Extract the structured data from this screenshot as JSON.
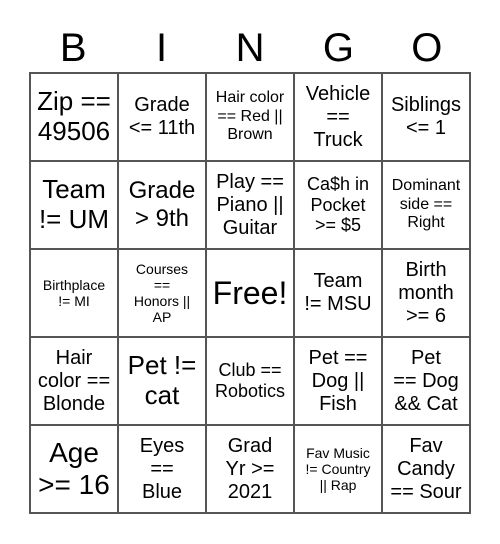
{
  "header": [
    "B",
    "I",
    "N",
    "G",
    "O"
  ],
  "cells": [
    "Zip ==\n49506",
    "Grade\n<= 11th",
    "Hair color\n== Red ||\nBrown",
    "Vehicle\n==\nTruck",
    "Siblings\n<= 1",
    "Team\n!= UM",
    "Grade\n> 9th",
    "Play ==\nPiano ||\nGuitar",
    "Ca$h in\nPocket\n>= $5",
    "Dominant\nside ==\nRight",
    "Birthplace\n!= MI",
    "Courses\n==\nHonors ||\nAP",
    "Free!",
    "Team\n!= MSU",
    "Birth\nmonth\n>= 6",
    "Hair\ncolor ==\nBlonde",
    "Pet !=\ncat",
    "Club ==\nRobotics",
    "Pet ==\nDog ||\nFish",
    "Pet\n== Dog\n&& Cat",
    "Age\n>= 16",
    "Eyes\n==\nBlue",
    "Grad\nYr >=\n2021",
    "Fav Music\n!= Country\n|| Rap",
    "Fav\nCandy\n== Sour"
  ]
}
